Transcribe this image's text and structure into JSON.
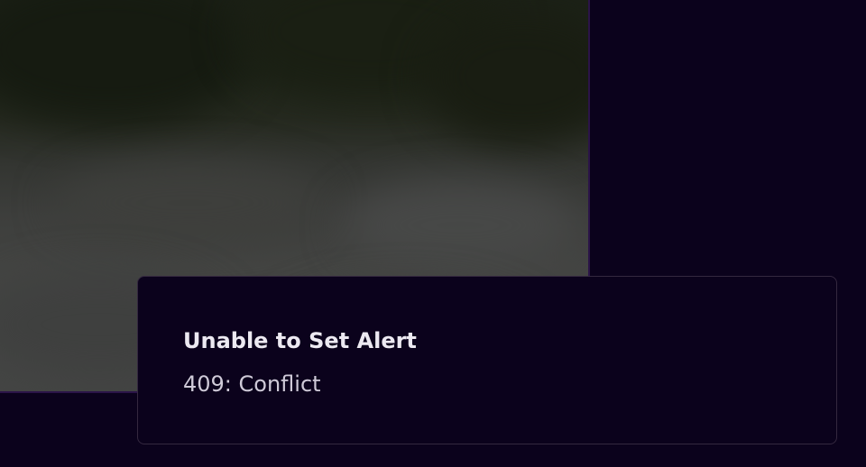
{
  "media": {
    "description_icon": "blurred-video-frame"
  },
  "toast": {
    "title": "Unable to Set Alert",
    "message": "409: Conflict"
  },
  "colors": {
    "background": "#0b021c",
    "toast_border": "#34283f",
    "frame_border": "#2b1448",
    "title_text": "#ece9f1",
    "message_text": "#cfcad8"
  }
}
